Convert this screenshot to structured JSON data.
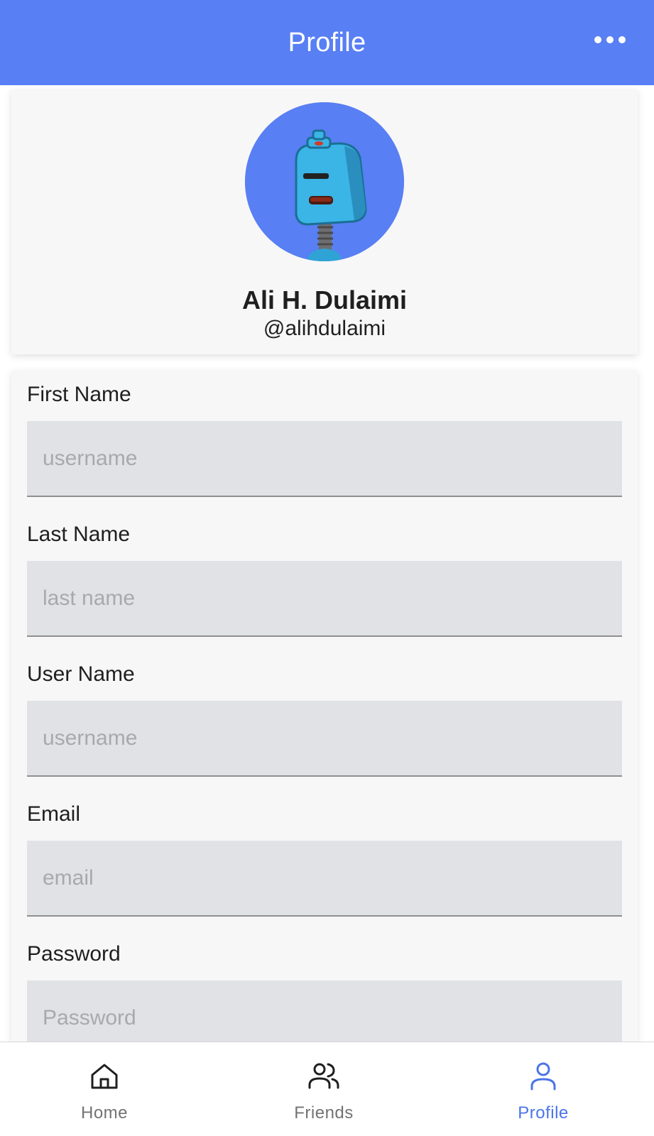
{
  "header": {
    "title": "Profile",
    "more_icon": "more-horizontal-icon"
  },
  "profile": {
    "name": "Ali H. Dulaimi",
    "handle": "@alihdulaimi",
    "avatar_icon": "robot-avatar-icon"
  },
  "form": {
    "fields": [
      {
        "label": "First Name",
        "placeholder": "username",
        "value": ""
      },
      {
        "label": "Last Name",
        "placeholder": "last name",
        "value": ""
      },
      {
        "label": "User Name",
        "placeholder": "username",
        "value": ""
      },
      {
        "label": "Email",
        "placeholder": "email",
        "value": ""
      },
      {
        "label": "Password",
        "placeholder": "Password",
        "value": ""
      }
    ]
  },
  "tabs": [
    {
      "label": "Home",
      "icon": "home-icon",
      "active": false
    },
    {
      "label": "Friends",
      "icon": "users-icon",
      "active": false
    },
    {
      "label": "Profile",
      "icon": "user-icon",
      "active": true
    }
  ],
  "colors": {
    "primary": "#587ff3",
    "active_tab": "#4b74e8",
    "card_bg": "#f7f7f7",
    "input_bg": "#e1e2e6"
  }
}
